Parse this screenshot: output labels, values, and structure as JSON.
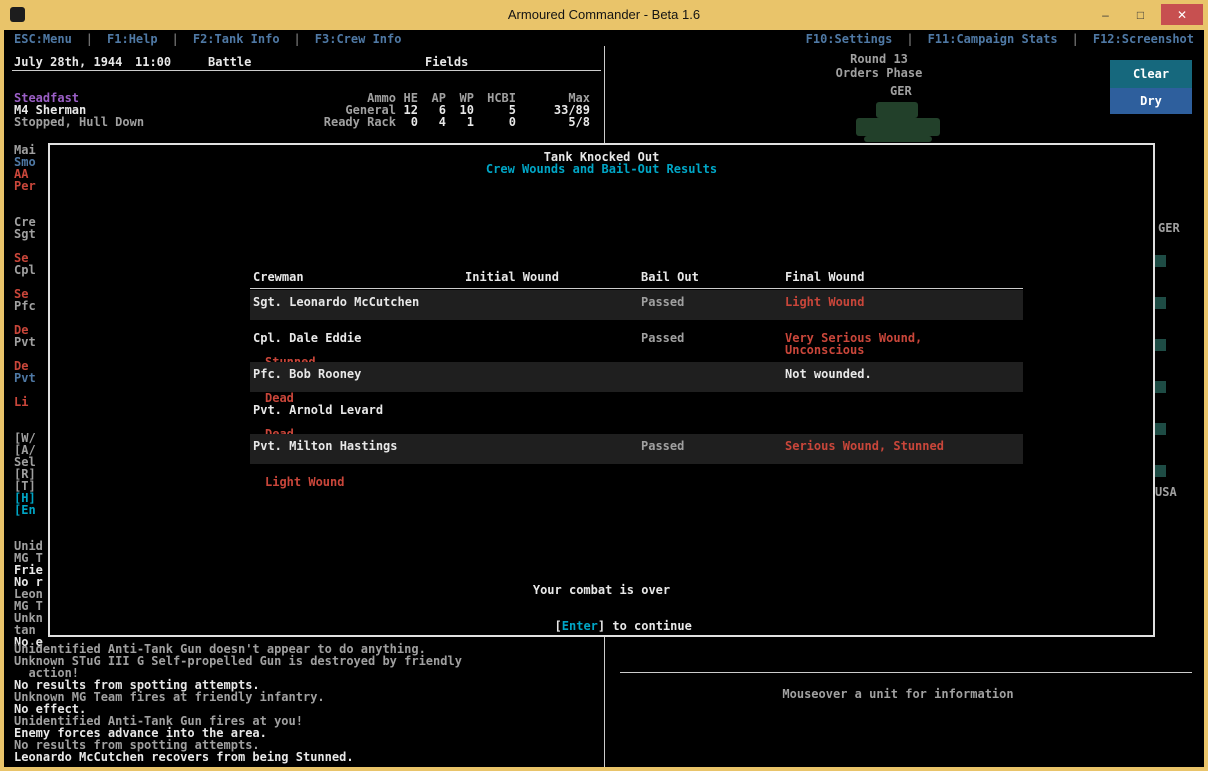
{
  "palette": {
    "titlebar": "#e9c46a",
    "close-red": "#c75050",
    "menu-blue": "#4f79a5",
    "cyan": "#00a6c6",
    "red": "#c9463a",
    "purple": "#9b5fc6",
    "gray": "#a0a0a0",
    "bright": "#e8e8e8",
    "stripe": "#1f1f1f",
    "line": "#cccccc",
    "weather-teal": "#16687d",
    "weather-blue": "#2e5f9d",
    "tank-green": "#22402a",
    "marker-teal": "#1e4c45"
  },
  "window": {
    "title": "Armoured Commander - Beta 1.6",
    "minimize": "–",
    "maximize": "□",
    "close": "✕"
  },
  "menu": {
    "separator": "|",
    "left": [
      "ESC:Menu",
      "F1:Help",
      "F2:Tank Info",
      "F3:Crew Info"
    ],
    "right": [
      "F10:Settings",
      "F11:Campaign Stats",
      "F12:Screenshot"
    ]
  },
  "status": {
    "date": "July 28th, 1944",
    "time": "11:00",
    "mode": "Battle",
    "terrain": "Fields"
  },
  "tank": {
    "morale": "Steadfast",
    "name": "M4 Sherman",
    "state": "Stopped, Hull Down"
  },
  "ammo": {
    "label": "Ammo",
    "cols": [
      "HE",
      "AP",
      "WP",
      "HCBI",
      "Max"
    ],
    "rows": [
      {
        "label": "General",
        "he": "12",
        "ap": "6",
        "wp": "10",
        "hcbi": "5",
        "max": "33/89"
      },
      {
        "label": "Ready Rack",
        "he": "0",
        "ap": "4",
        "wp": "1",
        "hcbi": "0",
        "max": "5/8"
      }
    ]
  },
  "round": {
    "number": "Round 13",
    "phase": "Orders Phase"
  },
  "weather": {
    "sky": "Clear",
    "ground": "Dry"
  },
  "map": {
    "enemy_label": "GER",
    "right_top": "GER",
    "right_bottom": "USA"
  },
  "dialog": {
    "title": "Tank Knocked Out",
    "subtitle": "Crew Wounds and Bail-Out Results",
    "headers": [
      "Crewman",
      "Initial Wound",
      "Bail Out",
      "Final Wound"
    ],
    "crew": [
      {
        "name": "Sgt. Leonardo McCutchen",
        "initial": "",
        "bail": "Passed",
        "final": "Light Wound",
        "final2": "",
        "status": ""
      },
      {
        "name": "Cpl. Dale Eddie",
        "initial": "",
        "bail": "Passed",
        "final": "Very Serious Wound,",
        "final2": "Unconscious",
        "status": "Stunned"
      },
      {
        "name": "Pfc. Bob Rooney",
        "initial": "",
        "bail": "",
        "final": "Not wounded.",
        "final2": "",
        "status": "Dead"
      },
      {
        "name": "Pvt. Arnold Levard",
        "initial": "",
        "bail": "",
        "final": "",
        "final2": "",
        "status": "Dead"
      },
      {
        "name": "Pvt. Milton Hastings",
        "initial": "",
        "bail": "Passed",
        "final": "Serious Wound, Stunned",
        "final2": "",
        "status": "Light Wound"
      }
    ],
    "footer_line1": "Your combat is over",
    "enter_prefix": "[",
    "enter_key": "Enter",
    "enter_suffix": "] to continue"
  },
  "fragments": [
    "Mai",
    "Smo",
    "AA",
    "Per",
    "Cre",
    "Sgt",
    "Se",
    "Cpl",
    "Se",
    "Pfc",
    "De",
    "Pvt",
    "De",
    "Pvt",
    "Li",
    "[W/",
    "[A/",
    "Sel",
    "[R]",
    "[T]",
    "[H]",
    "[En",
    "Unid",
    "MG T",
    "Frie",
    "No r",
    "Leon",
    "MG T",
    "Unkn",
    "tan",
    "No e"
  ],
  "log": [
    "Unidentified Anti-Tank Gun doesn't appear to do anything.",
    "Unknown STuG III G Self-propelled Gun is destroyed by friendly",
    "  action!",
    "No results from spotting attempts.",
    "Unknown MG Team fires at friendly infantry.",
    "No effect.",
    "Unidentified Anti-Tank Gun fires at you!",
    "Enemy forces advance into the area.",
    "No results from spotting attempts.",
    "Leonardo McCutchen recovers from being Stunned."
  ],
  "hint": "Mouseover a unit for information"
}
